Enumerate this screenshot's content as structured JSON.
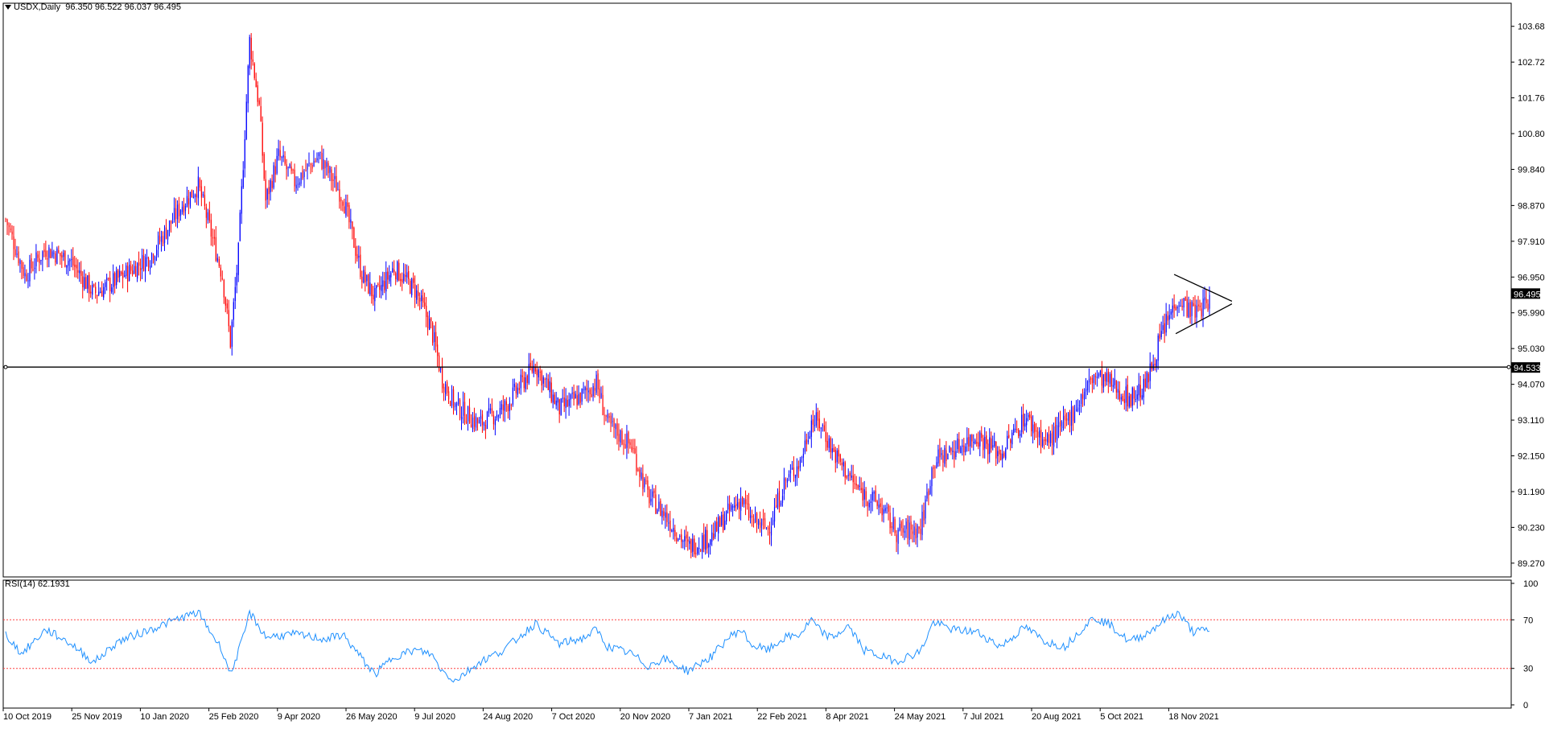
{
  "header": {
    "symbol_label": "USDX,Daily",
    "ohlc_label": "96.350 96.522 96.037 96.495"
  },
  "rsi_header": {
    "label": "RSI(14) 62.1931"
  },
  "colors": {
    "bull": "#0000ff",
    "bear": "#ff0000",
    "rsi_line": "#1e90ff",
    "rsi_level": "#ff4040",
    "price_tag_bg": "#000000",
    "price_tag_text": "#ffffff"
  },
  "chart_data": [
    {
      "type": "candlestick",
      "title": "USDX,Daily",
      "ylim": [
        88.9,
        104.3
      ],
      "y_ticks": [
        "103.680",
        "102.720",
        "101.760",
        "100.800",
        "99.840",
        "98.870",
        "97.910",
        "96.950",
        "95.990",
        "95.030",
        "94.070",
        "93.110",
        "92.150",
        "91.190",
        "90.230",
        "89.270"
      ],
      "x_tick_labels": [
        "10 Oct 2019",
        "25 Nov 2019",
        "10 Jan 2020",
        "25 Feb 2020",
        "9 Apr 2020",
        "26 May 2020",
        "9 Jul 2020",
        "24 Aug 2020",
        "7 Oct 2020",
        "20 Nov 2020",
        "7 Jan 2021",
        "22 Feb 2021",
        "8 Apr 2021",
        "24 May 2021",
        "7 Jul 2021",
        "20 Aug 2021",
        "5 Oct 2021",
        "18 Nov 2021"
      ],
      "current_price": "96.495",
      "horizontal_level": "94.533",
      "close_path": [
        {
          "bar": 0,
          "close": 98.5
        },
        {
          "bar": 12,
          "close": 97.0
        },
        {
          "bar": 25,
          "close": 97.7
        },
        {
          "bar": 40,
          "close": 97.4
        },
        {
          "bar": 55,
          "close": 96.5
        },
        {
          "bar": 70,
          "close": 96.9
        },
        {
          "bar": 90,
          "close": 97.5
        },
        {
          "bar": 110,
          "close": 98.9
        },
        {
          "bar": 120,
          "close": 99.4
        },
        {
          "bar": 135,
          "close": 97.0
        },
        {
          "bar": 140,
          "close": 95.2
        },
        {
          "bar": 145,
          "close": 97.6
        },
        {
          "bar": 152,
          "close": 103.3
        },
        {
          "bar": 158,
          "close": 101.5
        },
        {
          "bar": 162,
          "close": 99.0
        },
        {
          "bar": 170,
          "close": 100.2
        },
        {
          "bar": 180,
          "close": 99.5
        },
        {
          "bar": 195,
          "close": 100.2
        },
        {
          "bar": 210,
          "close": 99.1
        },
        {
          "bar": 222,
          "close": 97.0
        },
        {
          "bar": 230,
          "close": 96.4
        },
        {
          "bar": 242,
          "close": 97.2
        },
        {
          "bar": 255,
          "close": 96.6
        },
        {
          "bar": 265,
          "close": 95.6
        },
        {
          "bar": 272,
          "close": 94.2
        },
        {
          "bar": 280,
          "close": 93.5
        },
        {
          "bar": 295,
          "close": 93.0
        },
        {
          "bar": 310,
          "close": 93.4
        },
        {
          "bar": 330,
          "close": 94.6
        },
        {
          "bar": 345,
          "close": 93.4
        },
        {
          "bar": 360,
          "close": 93.8
        },
        {
          "bar": 368,
          "close": 94.1
        },
        {
          "bar": 375,
          "close": 93.0
        },
        {
          "bar": 390,
          "close": 92.4
        },
        {
          "bar": 400,
          "close": 91.1
        },
        {
          "bar": 410,
          "close": 90.6
        },
        {
          "bar": 425,
          "close": 89.7
        },
        {
          "bar": 440,
          "close": 90.0
        },
        {
          "bar": 450,
          "close": 90.6
        },
        {
          "bar": 458,
          "close": 91.0
        },
        {
          "bar": 465,
          "close": 90.4
        },
        {
          "bar": 475,
          "close": 90.2
        },
        {
          "bar": 485,
          "close": 91.4
        },
        {
          "bar": 495,
          "close": 92.0
        },
        {
          "bar": 502,
          "close": 93.1
        },
        {
          "bar": 508,
          "close": 93.0
        },
        {
          "bar": 515,
          "close": 92.3
        },
        {
          "bar": 530,
          "close": 91.3
        },
        {
          "bar": 545,
          "close": 90.8
        },
        {
          "bar": 555,
          "close": 90.1
        },
        {
          "bar": 570,
          "close": 90.2
        },
        {
          "bar": 578,
          "close": 92.0
        },
        {
          "bar": 590,
          "close": 92.3
        },
        {
          "bar": 605,
          "close": 92.7
        },
        {
          "bar": 620,
          "close": 92.2
        },
        {
          "bar": 635,
          "close": 93.2
        },
        {
          "bar": 648,
          "close": 92.5
        },
        {
          "bar": 660,
          "close": 93.0
        },
        {
          "bar": 670,
          "close": 93.7
        },
        {
          "bar": 678,
          "close": 94.3
        },
        {
          "bar": 688,
          "close": 94.1
        },
        {
          "bar": 700,
          "close": 93.7
        },
        {
          "bar": 710,
          "close": 94.0
        },
        {
          "bar": 720,
          "close": 95.4
        },
        {
          "bar": 730,
          "close": 96.4
        },
        {
          "bar": 740,
          "close": 96.0
        },
        {
          "bar": 750,
          "close": 96.3
        }
      ]
    },
    {
      "type": "line",
      "title": "RSI(14) 62.1931",
      "ylim": [
        0,
        100
      ],
      "y_ticks": [
        "100",
        "70",
        "30",
        "0"
      ],
      "levels": [
        70,
        30
      ],
      "rsi_path": [
        {
          "bar": 0,
          "value": 58
        },
        {
          "bar": 10,
          "value": 42
        },
        {
          "bar": 25,
          "value": 62
        },
        {
          "bar": 40,
          "value": 51
        },
        {
          "bar": 55,
          "value": 35
        },
        {
          "bar": 70,
          "value": 52
        },
        {
          "bar": 90,
          "value": 62
        },
        {
          "bar": 110,
          "value": 72
        },
        {
          "bar": 120,
          "value": 76
        },
        {
          "bar": 135,
          "value": 45
        },
        {
          "bar": 140,
          "value": 25
        },
        {
          "bar": 148,
          "value": 55
        },
        {
          "bar": 152,
          "value": 76
        },
        {
          "bar": 162,
          "value": 56
        },
        {
          "bar": 180,
          "value": 58
        },
        {
          "bar": 200,
          "value": 54
        },
        {
          "bar": 210,
          "value": 58
        },
        {
          "bar": 222,
          "value": 38
        },
        {
          "bar": 230,
          "value": 25
        },
        {
          "bar": 242,
          "value": 40
        },
        {
          "bar": 255,
          "value": 45
        },
        {
          "bar": 265,
          "value": 42
        },
        {
          "bar": 272,
          "value": 28
        },
        {
          "bar": 280,
          "value": 20
        },
        {
          "bar": 295,
          "value": 35
        },
        {
          "bar": 310,
          "value": 45
        },
        {
          "bar": 330,
          "value": 67
        },
        {
          "bar": 345,
          "value": 50
        },
        {
          "bar": 360,
          "value": 55
        },
        {
          "bar": 368,
          "value": 62
        },
        {
          "bar": 375,
          "value": 48
        },
        {
          "bar": 390,
          "value": 42
        },
        {
          "bar": 400,
          "value": 32
        },
        {
          "bar": 410,
          "value": 38
        },
        {
          "bar": 425,
          "value": 28
        },
        {
          "bar": 440,
          "value": 40
        },
        {
          "bar": 450,
          "value": 55
        },
        {
          "bar": 458,
          "value": 62
        },
        {
          "bar": 465,
          "value": 49
        },
        {
          "bar": 475,
          "value": 45
        },
        {
          "bar": 485,
          "value": 55
        },
        {
          "bar": 495,
          "value": 58
        },
        {
          "bar": 502,
          "value": 70
        },
        {
          "bar": 508,
          "value": 60
        },
        {
          "bar": 515,
          "value": 55
        },
        {
          "bar": 525,
          "value": 65
        },
        {
          "bar": 535,
          "value": 45
        },
        {
          "bar": 545,
          "value": 40
        },
        {
          "bar": 555,
          "value": 36
        },
        {
          "bar": 570,
          "value": 44
        },
        {
          "bar": 578,
          "value": 68
        },
        {
          "bar": 590,
          "value": 62
        },
        {
          "bar": 605,
          "value": 60
        },
        {
          "bar": 620,
          "value": 48
        },
        {
          "bar": 635,
          "value": 64
        },
        {
          "bar": 648,
          "value": 52
        },
        {
          "bar": 660,
          "value": 48
        },
        {
          "bar": 670,
          "value": 62
        },
        {
          "bar": 678,
          "value": 72
        },
        {
          "bar": 688,
          "value": 66
        },
        {
          "bar": 700,
          "value": 52
        },
        {
          "bar": 710,
          "value": 58
        },
        {
          "bar": 720,
          "value": 68
        },
        {
          "bar": 730,
          "value": 76
        },
        {
          "bar": 740,
          "value": 60
        },
        {
          "bar": 750,
          "value": 62
        }
      ]
    }
  ]
}
